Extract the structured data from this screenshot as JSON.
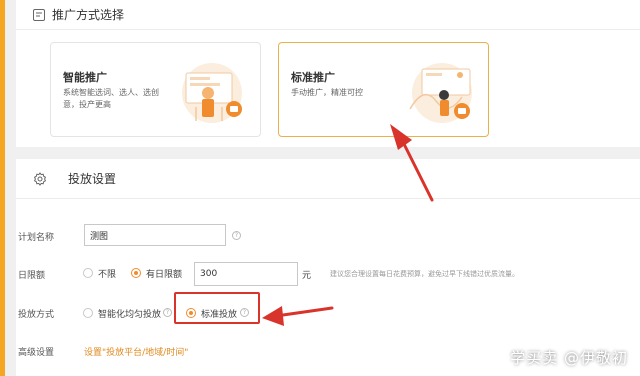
{
  "promo_section": {
    "title": "推广方式选择",
    "cards": [
      {
        "title": "智能推广",
        "desc": "系统智能选词、选人、选创意，投产更高",
        "selected": false
      },
      {
        "title": "标准推广",
        "desc": "手动推广，精准可控",
        "selected": true
      }
    ]
  },
  "delivery_section": {
    "title": "投放设置",
    "plan_name": {
      "label": "计划名称",
      "value": "测图",
      "help": "?"
    },
    "daily_limit": {
      "label": "日限额",
      "options": [
        "不限",
        "有日限额"
      ],
      "selected": "有日限额",
      "value": "300",
      "unit": "元",
      "hint": "建议您合理设置每日花费预算，避免过早下线错过优质流量。"
    },
    "delivery_method": {
      "label": "投放方式",
      "options": [
        "智能化均匀投放",
        "标准投放"
      ],
      "selected": "标准投放",
      "help": "?"
    },
    "advanced": {
      "label": "高级设置",
      "link": "设置\"投放平台/地域/时间\""
    }
  },
  "watermark": "学买卖 @伊敬初",
  "colors": {
    "accent": "#f08c2d",
    "annotation_red": "#d9342b",
    "selected_border": "#e8b24a"
  }
}
